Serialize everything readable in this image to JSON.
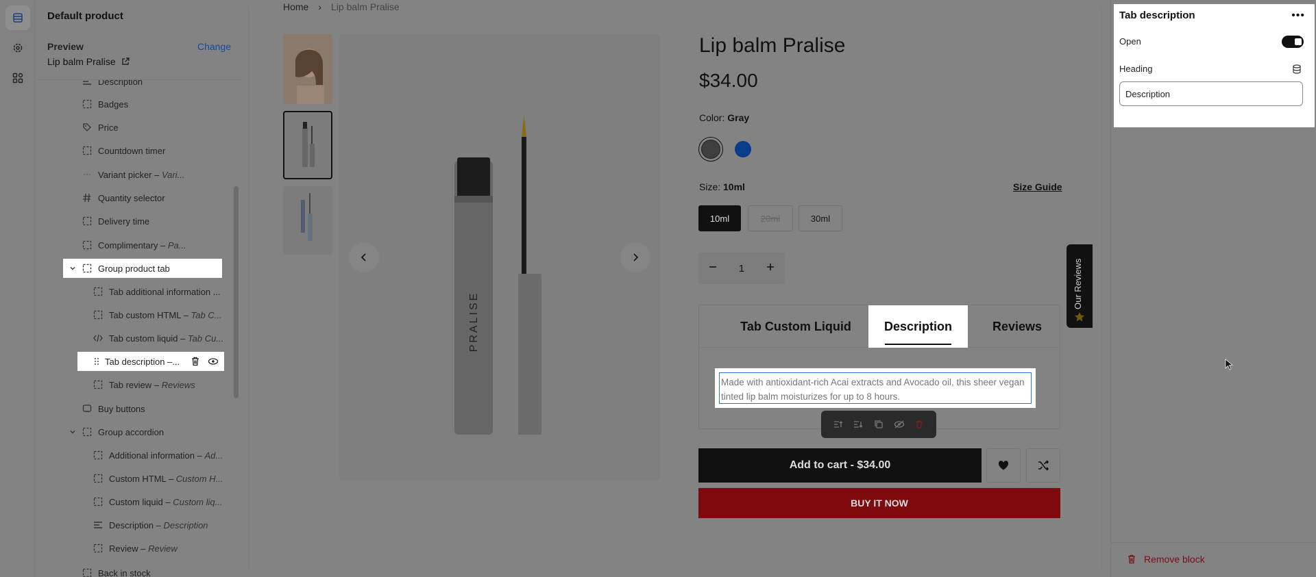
{
  "sidebar": {
    "title": "Default product",
    "preview_label": "Preview",
    "change_label": "Change",
    "product_link": "Lip balm Pralise",
    "tree": [
      {
        "label": "Description",
        "hidden": true
      },
      {
        "label": "Badges",
        "hidden": true
      },
      {
        "label": "Price",
        "hidden": false
      },
      {
        "label": "Countdown timer",
        "hidden": true
      },
      {
        "label": "Variant picker",
        "suffix": "Vari...",
        "hidden": false
      },
      {
        "label": "Quantity selector",
        "hidden": false
      },
      {
        "label": "Delivery time",
        "hidden": true
      },
      {
        "label": "Complimentary",
        "suffix": "Pa...",
        "hidden": true
      },
      {
        "label": "Group product tab"
      },
      {
        "label": "Tab additional information ..."
      },
      {
        "label": "Tab custom HTML",
        "suffix": "Tab C..."
      },
      {
        "label": "Tab custom liquid",
        "suffix": "Tab Cu..."
      },
      {
        "label": "Tab description –..."
      },
      {
        "label": "Tab review",
        "suffix": "Reviews"
      },
      {
        "label": "Buy buttons"
      },
      {
        "label": "Group accordion",
        "hidden": true
      },
      {
        "label": "Additional information",
        "suffix": "Ad..."
      },
      {
        "label": "Custom HTML",
        "suffix": "Custom H..."
      },
      {
        "label": "Custom liquid",
        "suffix": "Custom liq..."
      },
      {
        "label": "Description",
        "suffix": "Description"
      },
      {
        "label": "Review",
        "suffix": "Review"
      },
      {
        "label": "Back in stock",
        "hidden": true
      }
    ]
  },
  "preview": {
    "breadcrumb": {
      "home": "Home",
      "sep": "›",
      "current": "Lip balm Pralise"
    },
    "product_title": "Lip balm Pralise",
    "price": "$34.00",
    "color_label": "Color:",
    "color_value": "Gray",
    "size_label": "Size:",
    "size_value": "10ml",
    "size_guide": "Size Guide",
    "sizes": [
      "10ml",
      "20ml",
      "30ml"
    ],
    "quantity": "1",
    "tabs": [
      "Tab Custom Liquid",
      "Description",
      "Reviews"
    ],
    "description_text": "Made with antioxidant-rich Acai extracts and Avocado oil, this sheer vegan tinted lip balm moisturizes for up to 8 hours.",
    "add_to_cart": "Add to cart",
    "add_to_cart_price": "$34.00",
    "buy_now": "BUY IT NOW",
    "reviews_tab": "Our Reviews",
    "tube_brand": "PRALISE"
  },
  "panel": {
    "title": "Tab description",
    "open_label": "Open",
    "open_value": true,
    "heading_label": "Heading",
    "heading_value": "Description",
    "remove_block": "Remove block"
  },
  "colors": {
    "accent_blue": "#124c9c",
    "buy_now_red": "#7f0a0e",
    "swatch_gray": "#3f3f3f",
    "swatch_blue": "#0a3c8c"
  }
}
